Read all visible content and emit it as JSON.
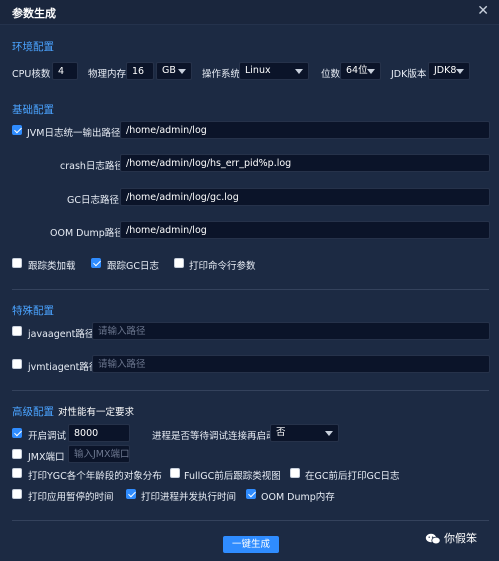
{
  "dialog": {
    "title": "参数生成"
  },
  "env": {
    "section": "环境配置",
    "cpu_label": "CPU核数",
    "cpu_value": "4",
    "mem_label": "物理内存",
    "mem_value": "16",
    "mem_unit": "GB",
    "os_label": "操作系统",
    "os_value": "Linux",
    "bits_label": "位数",
    "bits_value": "64位",
    "jdk_label": "JDK版本",
    "jdk_value": "JDK8"
  },
  "basic": {
    "section": "基础配置",
    "jvm_log_label": "JVM日志统一输出路径",
    "jvm_log_value": "/home/admin/log",
    "crash_label": "crash日志路径",
    "crash_value": "/home/admin/log/hs_err_pid%p.log",
    "gc_label": "GC日志路径",
    "gc_value": "/home/admin/log/gc.log",
    "oom_label": "OOM Dump路径",
    "oom_value": "/home/admin/log",
    "trace_class": "跟踪类加载",
    "trace_gc": "跟踪GC日志",
    "print_cmd": "打印命令行参数"
  },
  "special": {
    "section": "特殊配置",
    "javaagent_label": "javaagent路径",
    "javaagent_placeholder": "请输入路径",
    "jvmtiagent_label": "jvmtiagent路径",
    "jvmtiagent_placeholder": "请输入路径"
  },
  "advanced": {
    "section": "高级配置",
    "note": "对性能有一定要求",
    "debug_label": "开启调试",
    "debug_port": "8000",
    "wait_label": "进程是否等待调试连接再启动",
    "wait_value": "否",
    "jmx_label": "JMX端口",
    "jmx_placeholder": "输入JMX端口",
    "ygc_label": "打印YGC各个年龄段的对象分布",
    "fullgc_label": "FullGC前后跟踪类视图",
    "gc_log_label": "在GC前后打印GC日志",
    "pause_label": "打印应用暂停的时间",
    "concurrent_label": "打印进程并发执行时间",
    "oom_dump_label": "OOM Dump内存"
  },
  "footer": {
    "generate": "一键生成",
    "watermark": "你假笨"
  },
  "colors": {
    "accent": "#2f8cff",
    "section": "#4aa3ff",
    "background": "#1c2a43"
  }
}
